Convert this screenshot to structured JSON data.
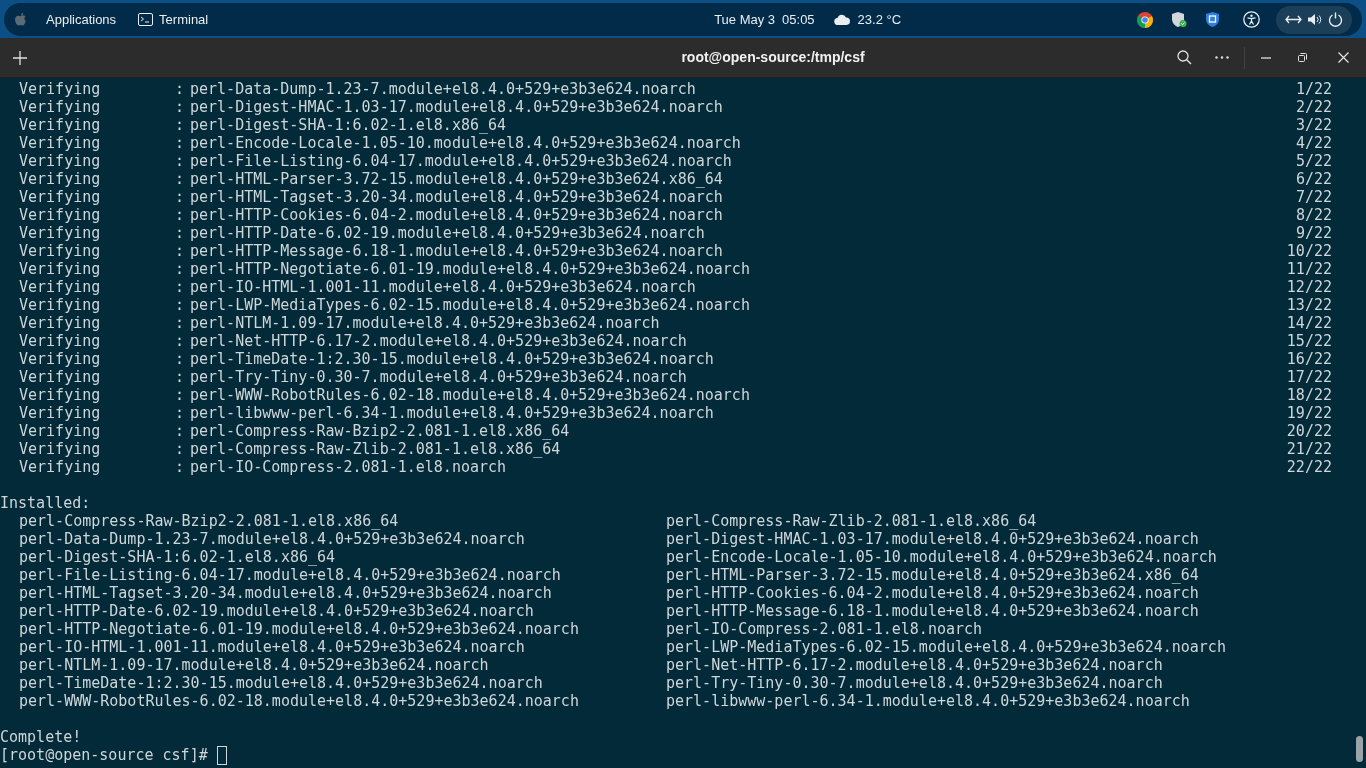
{
  "top_bar": {
    "menu": "Applications",
    "task": "Terminal",
    "date": "Tue May 3",
    "time": "05:05",
    "weather": "23.2 °C"
  },
  "window": {
    "title": "root@open-source:/tmp/csf"
  },
  "verify_lines": [
    {
      "action": "Verifying",
      "separator": ":",
      "package": "perl-Data-Dump-1.23-7.module+el8.4.0+529+e3b3e624.noarch",
      "progress": "1/22"
    },
    {
      "action": "Verifying",
      "separator": ":",
      "package": "perl-Digest-HMAC-1.03-17.module+el8.4.0+529+e3b3e624.noarch",
      "progress": "2/22"
    },
    {
      "action": "Verifying",
      "separator": ":",
      "package": "perl-Digest-SHA-1:6.02-1.el8.x86_64",
      "progress": "3/22"
    },
    {
      "action": "Verifying",
      "separator": ":",
      "package": "perl-Encode-Locale-1.05-10.module+el8.4.0+529+e3b3e624.noarch",
      "progress": "4/22"
    },
    {
      "action": "Verifying",
      "separator": ":",
      "package": "perl-File-Listing-6.04-17.module+el8.4.0+529+e3b3e624.noarch",
      "progress": "5/22"
    },
    {
      "action": "Verifying",
      "separator": ":",
      "package": "perl-HTML-Parser-3.72-15.module+el8.4.0+529+e3b3e624.x86_64",
      "progress": "6/22"
    },
    {
      "action": "Verifying",
      "separator": ":",
      "package": "perl-HTML-Tagset-3.20-34.module+el8.4.0+529+e3b3e624.noarch",
      "progress": "7/22"
    },
    {
      "action": "Verifying",
      "separator": ":",
      "package": "perl-HTTP-Cookies-6.04-2.module+el8.4.0+529+e3b3e624.noarch",
      "progress": "8/22"
    },
    {
      "action": "Verifying",
      "separator": ":",
      "package": "perl-HTTP-Date-6.02-19.module+el8.4.0+529+e3b3e624.noarch",
      "progress": "9/22"
    },
    {
      "action": "Verifying",
      "separator": ":",
      "package": "perl-HTTP-Message-6.18-1.module+el8.4.0+529+e3b3e624.noarch",
      "progress": "10/22"
    },
    {
      "action": "Verifying",
      "separator": ":",
      "package": "perl-HTTP-Negotiate-6.01-19.module+el8.4.0+529+e3b3e624.noarch",
      "progress": "11/22"
    },
    {
      "action": "Verifying",
      "separator": ":",
      "package": "perl-IO-HTML-1.001-11.module+el8.4.0+529+e3b3e624.noarch",
      "progress": "12/22"
    },
    {
      "action": "Verifying",
      "separator": ":",
      "package": "perl-LWP-MediaTypes-6.02-15.module+el8.4.0+529+e3b3e624.noarch",
      "progress": "13/22"
    },
    {
      "action": "Verifying",
      "separator": ":",
      "package": "perl-NTLM-1.09-17.module+el8.4.0+529+e3b3e624.noarch",
      "progress": "14/22"
    },
    {
      "action": "Verifying",
      "separator": ":",
      "package": "perl-Net-HTTP-6.17-2.module+el8.4.0+529+e3b3e624.noarch",
      "progress": "15/22"
    },
    {
      "action": "Verifying",
      "separator": ":",
      "package": "perl-TimeDate-1:2.30-15.module+el8.4.0+529+e3b3e624.noarch",
      "progress": "16/22"
    },
    {
      "action": "Verifying",
      "separator": ":",
      "package": "perl-Try-Tiny-0.30-7.module+el8.4.0+529+e3b3e624.noarch",
      "progress": "17/22"
    },
    {
      "action": "Verifying",
      "separator": ":",
      "package": "perl-WWW-RobotRules-6.02-18.module+el8.4.0+529+e3b3e624.noarch",
      "progress": "18/22"
    },
    {
      "action": "Verifying",
      "separator": ":",
      "package": "perl-libwww-perl-6.34-1.module+el8.4.0+529+e3b3e624.noarch",
      "progress": "19/22"
    },
    {
      "action": "Verifying",
      "separator": ":",
      "package": "perl-Compress-Raw-Bzip2-2.081-1.el8.x86_64",
      "progress": "20/22"
    },
    {
      "action": "Verifying",
      "separator": ":",
      "package": "perl-Compress-Raw-Zlib-2.081-1.el8.x86_64",
      "progress": "21/22"
    },
    {
      "action": "Verifying",
      "separator": ":",
      "package": "perl-IO-Compress-2.081-1.el8.noarch",
      "progress": "22/22"
    }
  ],
  "installed_header": "Installed:",
  "installed_packages": [
    "perl-Compress-Raw-Bzip2-2.081-1.el8.x86_64",
    "perl-Compress-Raw-Zlib-2.081-1.el8.x86_64",
    "perl-Data-Dump-1.23-7.module+el8.4.0+529+e3b3e624.noarch",
    "perl-Digest-HMAC-1.03-17.module+el8.4.0+529+e3b3e624.noarch",
    "perl-Digest-SHA-1:6.02-1.el8.x86_64",
    "perl-Encode-Locale-1.05-10.module+el8.4.0+529+e3b3e624.noarch",
    "perl-File-Listing-6.04-17.module+el8.4.0+529+e3b3e624.noarch",
    "perl-HTML-Parser-3.72-15.module+el8.4.0+529+e3b3e624.x86_64",
    "perl-HTML-Tagset-3.20-34.module+el8.4.0+529+e3b3e624.noarch",
    "perl-HTTP-Cookies-6.04-2.module+el8.4.0+529+e3b3e624.noarch",
    "perl-HTTP-Date-6.02-19.module+el8.4.0+529+e3b3e624.noarch",
    "perl-HTTP-Message-6.18-1.module+el8.4.0+529+e3b3e624.noarch",
    "perl-HTTP-Negotiate-6.01-19.module+el8.4.0+529+e3b3e624.noarch",
    "perl-IO-Compress-2.081-1.el8.noarch",
    "perl-IO-HTML-1.001-11.module+el8.4.0+529+e3b3e624.noarch",
    "perl-LWP-MediaTypes-6.02-15.module+el8.4.0+529+e3b3e624.noarch",
    "perl-NTLM-1.09-17.module+el8.4.0+529+e3b3e624.noarch",
    "perl-Net-HTTP-6.17-2.module+el8.4.0+529+e3b3e624.noarch",
    "perl-TimeDate-1:2.30-15.module+el8.4.0+529+e3b3e624.noarch",
    "perl-Try-Tiny-0.30-7.module+el8.4.0+529+e3b3e624.noarch",
    "perl-WWW-RobotRules-6.02-18.module+el8.4.0+529+e3b3e624.noarch",
    "perl-libwww-perl-6.34-1.module+el8.4.0+529+e3b3e624.noarch"
  ],
  "complete": "Complete!",
  "prompt": "[root@open-source csf]#"
}
